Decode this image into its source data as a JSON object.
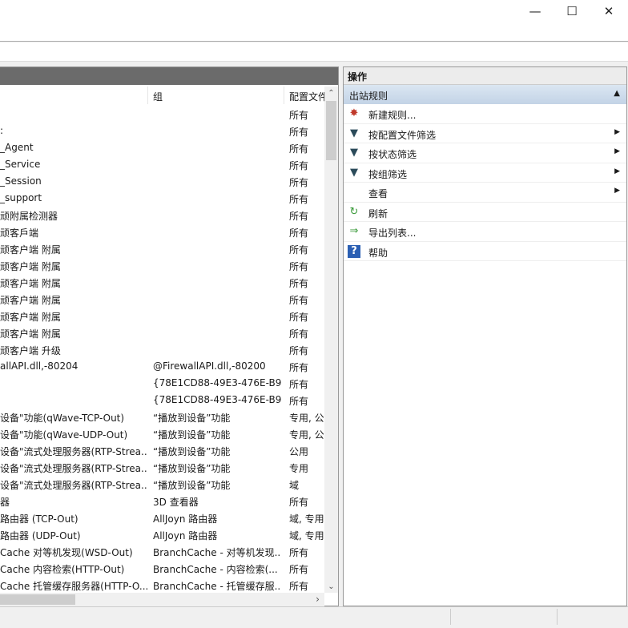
{
  "window": {
    "minimize": "—",
    "maximize": "☐",
    "close": "✕"
  },
  "table": {
    "columns": {
      "name": "",
      "group": "组",
      "profile": "配置文件"
    },
    "rows": [
      {
        "name": "",
        "group": "",
        "profile": "所有"
      },
      {
        "name": ":",
        "group": "",
        "profile": "所有"
      },
      {
        "name": "_Agent",
        "group": "",
        "profile": "所有"
      },
      {
        "name": "_Service",
        "group": "",
        "profile": "所有"
      },
      {
        "name": "_Session",
        "group": "",
        "profile": "所有"
      },
      {
        "name": "_support",
        "group": "",
        "profile": "所有"
      },
      {
        "name": "顽附属检测器",
        "group": "",
        "profile": "所有"
      },
      {
        "name": "顽客戶端",
        "group": "",
        "profile": "所有"
      },
      {
        "name": "顽客户端 附属",
        "group": "",
        "profile": "所有"
      },
      {
        "name": "顽客户端 附属",
        "group": "",
        "profile": "所有"
      },
      {
        "name": "顽客户端 附属",
        "group": "",
        "profile": "所有"
      },
      {
        "name": "顽客户端 附属",
        "group": "",
        "profile": "所有"
      },
      {
        "name": "顽客户端 附属",
        "group": "",
        "profile": "所有"
      },
      {
        "name": "顽客户端 附属",
        "group": "",
        "profile": "所有"
      },
      {
        "name": "顽客户端 升级",
        "group": "",
        "profile": "所有"
      },
      {
        "name": "allAPI.dll,-80204",
        "group": "@FirewallAPI.dll,-80200",
        "profile": "所有"
      },
      {
        "name": "",
        "group": "{78E1CD88-49E3-476E-B9...",
        "profile": "所有"
      },
      {
        "name": "",
        "group": "{78E1CD88-49E3-476E-B9...",
        "profile": "所有"
      },
      {
        "name": "设备\"功能(qWave-TCP-Out)",
        "group": "“播放到设备”功能",
        "profile": "专用, 公"
      },
      {
        "name": "设备\"功能(qWave-UDP-Out)",
        "group": "“播放到设备”功能",
        "profile": "专用, 公"
      },
      {
        "name": "设备\"流式处理服务器(RTP-Strea...",
        "group": "“播放到设备”功能",
        "profile": "公用"
      },
      {
        "name": "设备\"流式处理服务器(RTP-Strea...",
        "group": "“播放到设备”功能",
        "profile": "专用"
      },
      {
        "name": "设备\"流式处理服务器(RTP-Strea...",
        "group": "“播放到设备”功能",
        "profile": "域"
      },
      {
        "name": "器",
        "group": "3D 查看器",
        "profile": "所有"
      },
      {
        "name": " 路由器 (TCP-Out)",
        "group": "AllJoyn 路由器",
        "profile": "域, 专用"
      },
      {
        "name": " 路由器 (UDP-Out)",
        "group": "AllJoyn 路由器",
        "profile": "域, 专用"
      },
      {
        "name": "Cache 对等机发现(WSD-Out)",
        "group": "BranchCache - 对等机发现...",
        "profile": "所有"
      },
      {
        "name": "Cache 内容检索(HTTP-Out)",
        "group": "BranchCache - 内容检索(...",
        "profile": "所有"
      },
      {
        "name": "Cache 托管缓存服务器(HTTP-O...",
        "group": "BranchCache - 托管缓存服...",
        "profile": "所有"
      }
    ]
  },
  "actions": {
    "title": "操作",
    "section": "出站规则",
    "items": [
      {
        "label": "新建规则...",
        "icon": "new-rule-icon",
        "sub": false
      },
      {
        "label": "按配置文件筛选",
        "icon": "filter-icon",
        "sub": true
      },
      {
        "label": "按状态筛选",
        "icon": "filter-icon",
        "sub": true
      },
      {
        "label": "按组筛选",
        "icon": "filter-icon",
        "sub": true
      },
      {
        "label": "查看",
        "icon": "",
        "sub": true
      },
      {
        "label": "刷新",
        "icon": "refresh-icon",
        "sub": false
      },
      {
        "label": "导出列表...",
        "icon": "export-icon",
        "sub": false
      },
      {
        "label": "帮助",
        "icon": "help-icon",
        "sub": false
      }
    ]
  }
}
